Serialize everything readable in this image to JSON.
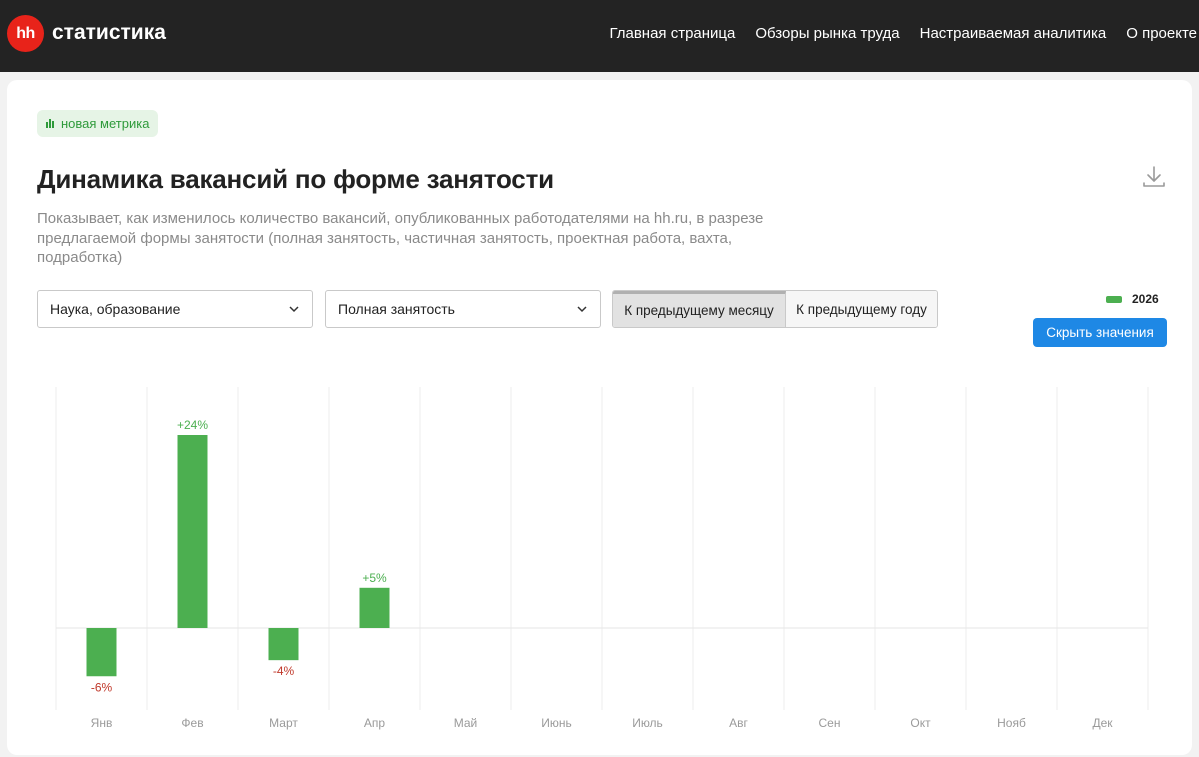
{
  "header": {
    "logo_text": "hh",
    "brand": "статистика",
    "nav": [
      "Главная страница",
      "Обзоры рынка труда",
      "Настраиваемая аналитика",
      "О проекте"
    ]
  },
  "badge": {
    "label": "новая метрика"
  },
  "title": "Динамика вакансий по форме занятости",
  "description": "Показывает, как изменилось количество вакансий, опубликованных работодателями на hh.ru, в разрезе предлагаемой формы занятости (полная занятость, частичная занятость, проектная работа, вахта, подработка)",
  "filters": {
    "industry": "Наука, образование",
    "employment_type": "Полная занятость"
  },
  "comparison": {
    "active": "К предыдущему месяцу",
    "inactive": "К предыдущему году"
  },
  "legend": {
    "label": "2026"
  },
  "hide_values_label": "Скрыть значения",
  "colors": {
    "positive": "#4caf50",
    "negative_label": "#c0392b",
    "accent": "#1e88e5",
    "brand": "#e8231a"
  },
  "icons": {
    "download": "download-icon",
    "chevron": "chevron-down-icon",
    "badge": "bar-chart-icon"
  },
  "chart_data": {
    "type": "bar",
    "categories": [
      "Янв",
      "Фев",
      "Март",
      "Апр",
      "Май",
      "Июнь",
      "Июль",
      "Авг",
      "Сен",
      "Окт",
      "Нояб",
      "Дек"
    ],
    "series": [
      {
        "name": "2026",
        "values": [
          -6,
          24,
          -4,
          5,
          null,
          null,
          null,
          null,
          null,
          null,
          null,
          null
        ]
      }
    ],
    "data_labels": [
      "-6%",
      "+24%",
      "-4%",
      "+5%",
      "",
      "",
      "",
      "",
      "",
      "",
      "",
      ""
    ],
    "ylim": [
      -10,
      30
    ],
    "grid": true
  }
}
